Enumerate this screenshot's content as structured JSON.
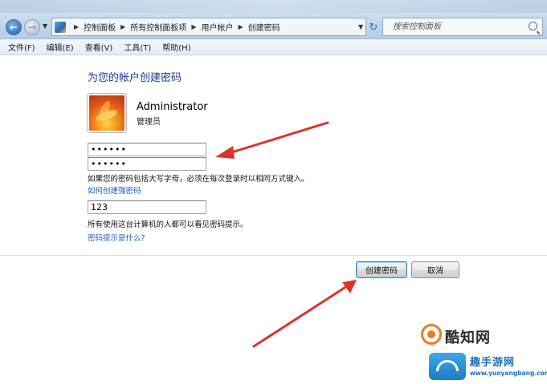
{
  "address_bar": {
    "crumbs": [
      "控制面板",
      "所有控制面板项",
      "用户帐户",
      "创建密码"
    ],
    "search_placeholder": "搜索控制面板"
  },
  "menu": [
    "文件(F)",
    "编辑(E)",
    "查看(V)",
    "工具(T)",
    "帮助(H)"
  ],
  "page": {
    "title": "为您的帐户创建密码",
    "user_name": "Administrator",
    "user_role": "管理员",
    "password_value": "••••••",
    "confirm_value": "••••••",
    "case_note": "如果您的密码包括大写字母，必须在每次登录时以相同方式键入。",
    "strong_pw_link": "如何创建强密码",
    "hint_value": "123",
    "hint_note": "所有使用这台计算机的人都可以看见密码提示。",
    "hint_link": "密码提示是什么?"
  },
  "buttons": {
    "create": "创建密码",
    "cancel": "取消"
  },
  "annotation_color": "#d9342b",
  "watermark": {
    "main": "酷知网",
    "brand": "趣手游网",
    "url": "www.yuoyangbang.com"
  }
}
